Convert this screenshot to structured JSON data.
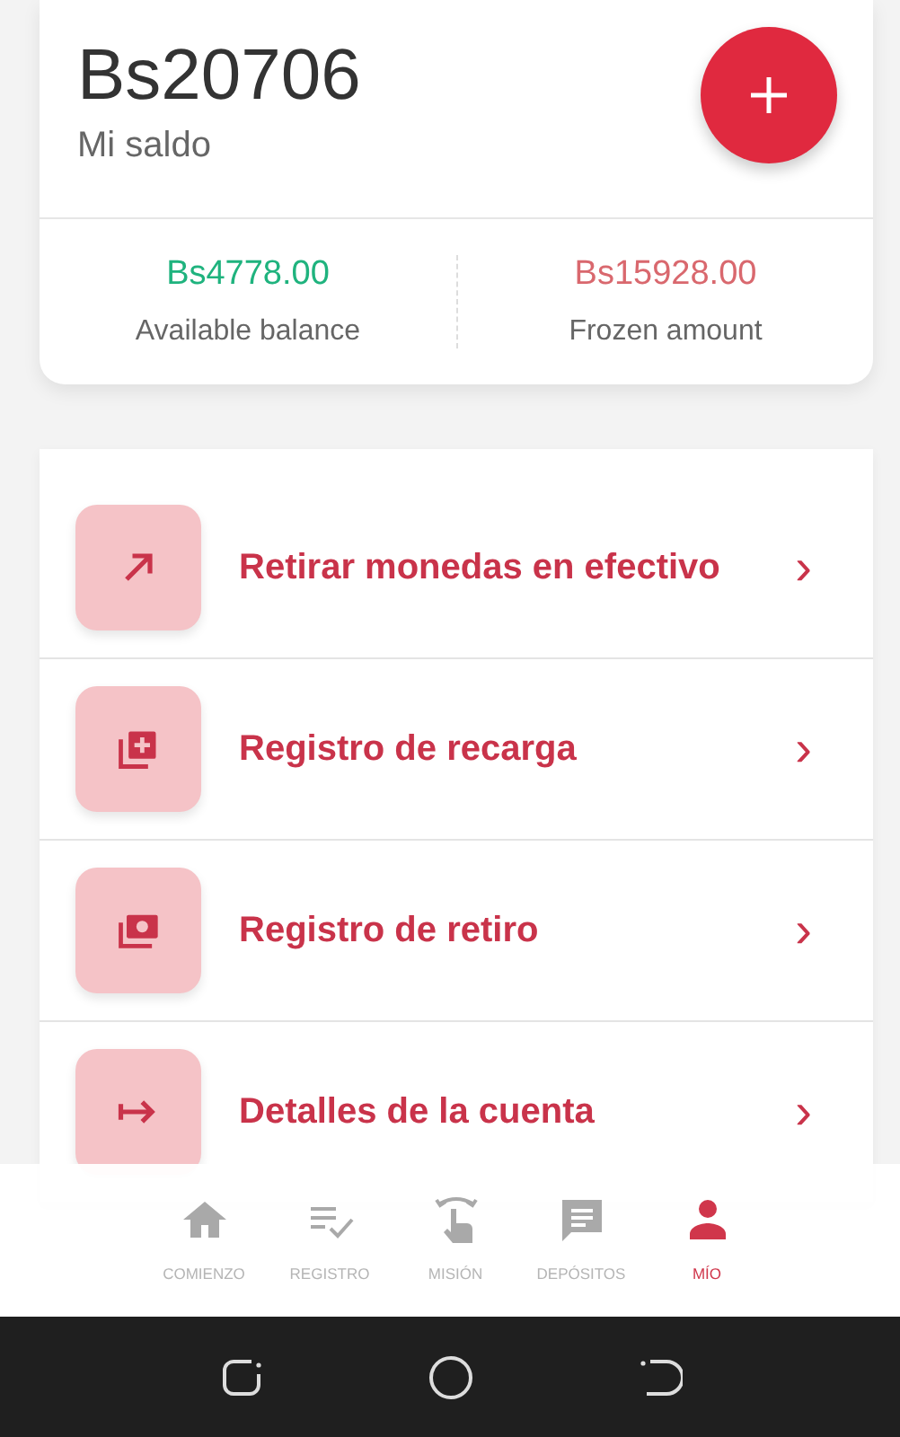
{
  "balance": {
    "amount": "Bs20706",
    "label": "Mi saldo"
  },
  "stats": [
    {
      "value": "Bs4778.00",
      "label": "Available balance",
      "color": "#1fb37e"
    },
    {
      "value": "Bs15928.00",
      "label": "Frozen amount",
      "color": "#d9686e"
    }
  ],
  "menu": [
    {
      "label": "Retirar monedas en efectivo",
      "chevron": "›"
    },
    {
      "label": "Registro de recarga",
      "chevron": "›"
    },
    {
      "label": "Registro de retiro",
      "chevron": "›"
    },
    {
      "label": "Detalles de la cuenta",
      "chevron": "›"
    }
  ],
  "tabs": [
    {
      "label": "COMIENZO",
      "selected": false
    },
    {
      "label": "REGISTRO",
      "selected": false
    },
    {
      "label": "MISIÓN",
      "selected": false
    },
    {
      "label": "DEPÓSITOS",
      "selected": false
    },
    {
      "label": "MÍO",
      "selected": true
    }
  ]
}
